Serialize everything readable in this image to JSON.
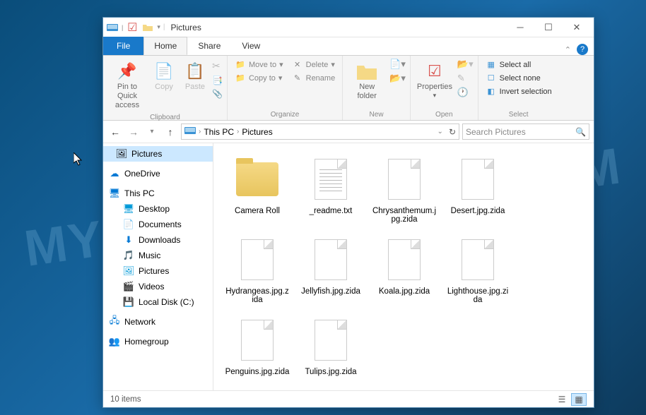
{
  "window": {
    "title": "Pictures"
  },
  "tabs": {
    "file": "File",
    "home": "Home",
    "share": "Share",
    "view": "View"
  },
  "ribbon": {
    "clipboard": {
      "label": "Clipboard",
      "pin": "Pin to Quick\naccess",
      "copy": "Copy",
      "paste": "Paste"
    },
    "organize": {
      "label": "Organize",
      "moveto": "Move to",
      "copyto": "Copy to",
      "delete": "Delete",
      "rename": "Rename"
    },
    "new": {
      "label": "New",
      "newfolder": "New\nfolder"
    },
    "open": {
      "label": "Open",
      "properties": "Properties"
    },
    "select": {
      "label": "Select",
      "all": "Select all",
      "none": "Select none",
      "invert": "Invert selection"
    }
  },
  "breadcrumb": {
    "root": "This PC",
    "current": "Pictures"
  },
  "search": {
    "placeholder": "Search Pictures"
  },
  "sidebar": {
    "pictures": "Pictures",
    "onedrive": "OneDrive",
    "thispc": "This PC",
    "desktop": "Desktop",
    "documents": "Documents",
    "downloads": "Downloads",
    "music": "Music",
    "pictures2": "Pictures",
    "videos": "Videos",
    "localdisk": "Local Disk (C:)",
    "network": "Network",
    "homegroup": "Homegroup"
  },
  "files": [
    {
      "name": "Camera Roll",
      "type": "folder"
    },
    {
      "name": "_readme.txt",
      "type": "txt"
    },
    {
      "name": "Chrysanthemum.jpg.zida",
      "type": "blank"
    },
    {
      "name": "Desert.jpg.zida",
      "type": "blank"
    },
    {
      "name": "Hydrangeas.jpg.zida",
      "type": "blank"
    },
    {
      "name": "Jellyfish.jpg.zida",
      "type": "blank"
    },
    {
      "name": "Koala.jpg.zida",
      "type": "blank"
    },
    {
      "name": "Lighthouse.jpg.zida",
      "type": "blank"
    },
    {
      "name": "Penguins.jpg.zida",
      "type": "blank"
    },
    {
      "name": "Tulips.jpg.zida",
      "type": "blank"
    }
  ],
  "status": {
    "count": "10 items"
  },
  "watermark": "MYANTISPYWARE.COM"
}
